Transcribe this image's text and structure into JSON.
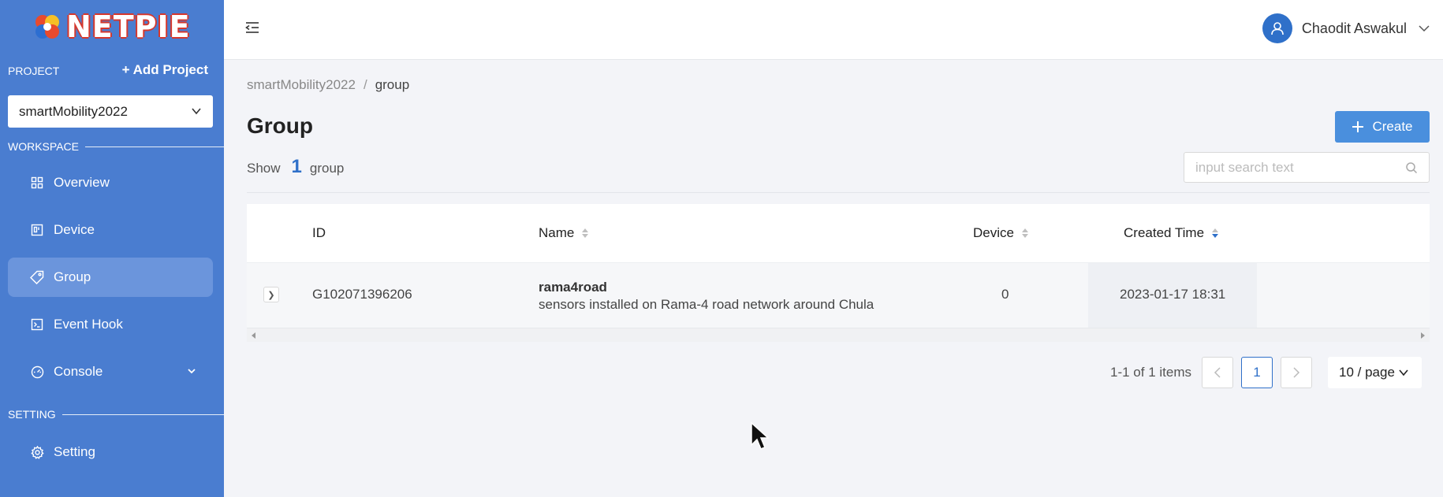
{
  "sidebar": {
    "logo_text": "NETPIE",
    "project_label": "PROJECT",
    "add_project_label": "+ Add Project",
    "selected_project": "smartMobility2022",
    "workspace_label": "WORKSPACE",
    "items": [
      {
        "label": "Overview",
        "icon": "grid-icon"
      },
      {
        "label": "Device",
        "icon": "device-icon"
      },
      {
        "label": "Group",
        "icon": "tag-icon",
        "active": true
      },
      {
        "label": "Event Hook",
        "icon": "terminal-icon"
      },
      {
        "label": "Console",
        "icon": "dashboard-icon"
      }
    ],
    "setting_section_label": "SETTING",
    "setting_item": {
      "label": "Setting",
      "icon": "gear-icon"
    }
  },
  "header": {
    "user_name": "Chaodit Aswakul"
  },
  "breadcrumb": {
    "root": "smartMobility2022",
    "separator": "/",
    "current": "group"
  },
  "page": {
    "title": "Group",
    "create_label": "Create",
    "show_prefix": "Show",
    "show_count": "1",
    "show_suffix": "group",
    "search_placeholder": "input search text"
  },
  "table": {
    "columns": {
      "id": "ID",
      "name": "Name",
      "device": "Device",
      "created": "Created Time"
    },
    "rows": [
      {
        "id": "G102071396206",
        "name": "rama4road",
        "description": "sensors installed on Rama-4 road network around Chula",
        "device": "0",
        "created": "2023-01-17 18:31"
      }
    ]
  },
  "pagination": {
    "range_text": "1-1 of 1 items",
    "current_page": "1",
    "page_size": "10 / page"
  },
  "colors": {
    "sidebar_bg": "#4a7dd0",
    "accent": "#2f70c9",
    "create_button": "#4a8fdd"
  }
}
